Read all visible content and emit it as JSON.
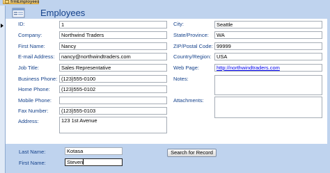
{
  "tab": {
    "label": "frmEmployees"
  },
  "form": {
    "title": "Employees"
  },
  "left_fields": [
    {
      "label": "ID:",
      "value": "1"
    },
    {
      "label": "Company:",
      "value": "Northwind Traders"
    },
    {
      "label": "First Name:",
      "value": "Nancy"
    },
    {
      "label": "E-mail Address:",
      "value": "nancy@northwindtraders.com"
    },
    {
      "label": "Job Title:",
      "value": "Sales Representative"
    },
    {
      "label": "Business Phone:",
      "value": "(123)555-0100"
    },
    {
      "label": "Home Phone:",
      "value": "(123)555-0102"
    },
    {
      "label": "Mobile Phone:",
      "value": ""
    },
    {
      "label": "Fax Number:",
      "value": "(123)555-0103"
    },
    {
      "label": "Address:",
      "value": "123 1st Avenue"
    }
  ],
  "right_fields": [
    {
      "label": "City:",
      "value": "Seattle"
    },
    {
      "label": "State/Province:",
      "value": "WA"
    },
    {
      "label": "ZIP/Postal Code:",
      "value": "99999"
    },
    {
      "label": "Country/Region:",
      "value": "USA"
    },
    {
      "label": "Web Page:",
      "value": "http://northwindtraders.com"
    },
    {
      "label": "Notes:",
      "value": ""
    },
    {
      "label": "Attachments:",
      "value": ""
    }
  ],
  "search": {
    "last_name_label": "Last Name:",
    "last_name_value": "Kotasa",
    "first_name_label": "First Name:",
    "first_name_value": "Steven",
    "button_label": "Search for Record"
  },
  "colors": {
    "background": "#bfd3ee",
    "label": "#15428b",
    "field_border": "#a5acb5"
  }
}
